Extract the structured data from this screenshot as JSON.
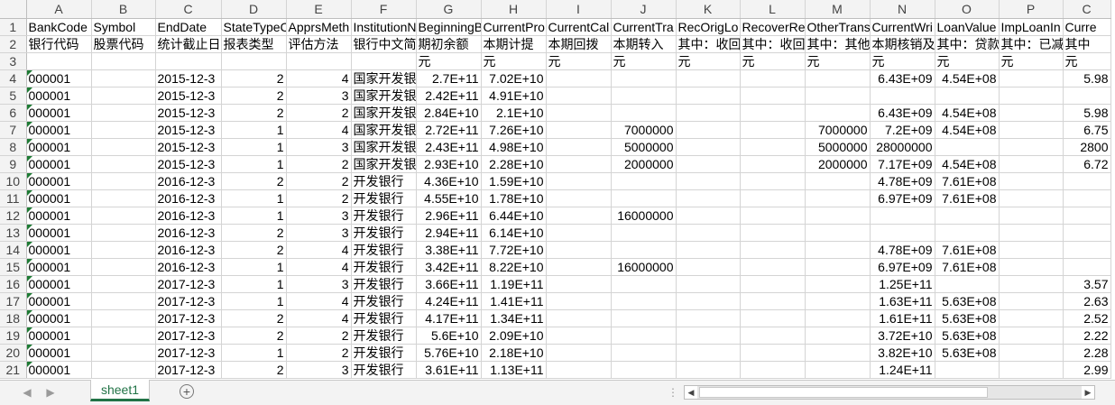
{
  "columns": [
    "A",
    "B",
    "C",
    "D",
    "E",
    "F",
    "G",
    "H",
    "I",
    "J",
    "K",
    "L",
    "M",
    "N",
    "O",
    "P",
    "C"
  ],
  "rows": [
    {
      "n": "1",
      "c": [
        "BankCode",
        "Symbol",
        "EndDate",
        "StateTypeC",
        "ApprsMeth",
        "InstitutionN",
        "BeginningB",
        "CurrentPro",
        "CurrentCal",
        "CurrentTra",
        "RecOrigLo",
        "RecoverRe",
        "OtherTrans",
        "CurrentWri",
        "LoanValue",
        "ImpLoanIn",
        "Curre"
      ]
    },
    {
      "n": "2",
      "c": [
        "银行代码",
        "股票代码",
        "统计截止日",
        "报表类型",
        "评估方法",
        "银行中文简",
        "期初余额",
        "本期计提",
        "本期回拨",
        "本期转入",
        "其中：收回",
        "其中：收回",
        "其中：其他",
        "本期核销及",
        "其中：贷款",
        "其中：已减",
        "其中"
      ]
    },
    {
      "n": "3",
      "c": [
        "",
        "",
        "",
        "",
        "",
        "",
        "元",
        "元",
        "元",
        "元",
        "元",
        "元",
        "元",
        "元",
        "元",
        "元",
        "元"
      ]
    },
    {
      "n": "4",
      "c": [
        "000001",
        "",
        "2015-12-3",
        "2",
        "4",
        "国家开发银",
        "2.7E+11",
        "7.02E+10",
        "",
        "",
        "",
        "",
        "",
        "6.43E+09",
        "4.54E+08",
        "",
        "5.98"
      ]
    },
    {
      "n": "5",
      "c": [
        "000001",
        "",
        "2015-12-3",
        "2",
        "3",
        "国家开发银",
        "2.42E+11",
        "4.91E+10",
        "",
        "",
        "",
        "",
        "",
        "",
        "",
        "",
        ""
      ]
    },
    {
      "n": "6",
      "c": [
        "000001",
        "",
        "2015-12-3",
        "2",
        "2",
        "国家开发银",
        "2.84E+10",
        "2.1E+10",
        "",
        "",
        "",
        "",
        "",
        "6.43E+09",
        "4.54E+08",
        "",
        "5.98"
      ]
    },
    {
      "n": "7",
      "c": [
        "000001",
        "",
        "2015-12-3",
        "1",
        "4",
        "国家开发银",
        "2.72E+11",
        "7.26E+10",
        "",
        "7000000",
        "",
        "",
        "7000000",
        "7.2E+09",
        "4.54E+08",
        "",
        "6.75"
      ]
    },
    {
      "n": "8",
      "c": [
        "000001",
        "",
        "2015-12-3",
        "1",
        "3",
        "国家开发银",
        "2.43E+11",
        "4.98E+10",
        "",
        "5000000",
        "",
        "",
        "5000000",
        "28000000",
        "",
        "",
        "2800"
      ]
    },
    {
      "n": "9",
      "c": [
        "000001",
        "",
        "2015-12-3",
        "1",
        "2",
        "国家开发银",
        "2.93E+10",
        "2.28E+10",
        "",
        "2000000",
        "",
        "",
        "2000000",
        "7.17E+09",
        "4.54E+08",
        "",
        "6.72"
      ]
    },
    {
      "n": "10",
      "c": [
        "000001",
        "",
        "2016-12-3",
        "2",
        "2",
        "开发银行",
        "4.36E+10",
        "1.59E+10",
        "",
        "",
        "",
        "",
        "",
        "4.78E+09",
        "7.61E+08",
        "",
        ""
      ]
    },
    {
      "n": "11",
      "c": [
        "000001",
        "",
        "2016-12-3",
        "1",
        "2",
        "开发银行",
        "4.55E+10",
        "1.78E+10",
        "",
        "",
        "",
        "",
        "",
        "6.97E+09",
        "7.61E+08",
        "",
        ""
      ]
    },
    {
      "n": "12",
      "c": [
        "000001",
        "",
        "2016-12-3",
        "1",
        "3",
        "开发银行",
        "2.96E+11",
        "6.44E+10",
        "",
        "16000000",
        "",
        "",
        "",
        "",
        "",
        "",
        ""
      ]
    },
    {
      "n": "13",
      "c": [
        "000001",
        "",
        "2016-12-3",
        "2",
        "3",
        "开发银行",
        "2.94E+11",
        "6.14E+10",
        "",
        "",
        "",
        "",
        "",
        "",
        "",
        "",
        ""
      ]
    },
    {
      "n": "14",
      "c": [
        "000001",
        "",
        "2016-12-3",
        "2",
        "4",
        "开发银行",
        "3.38E+11",
        "7.72E+10",
        "",
        "",
        "",
        "",
        "",
        "4.78E+09",
        "7.61E+08",
        "",
        ""
      ]
    },
    {
      "n": "15",
      "c": [
        "000001",
        "",
        "2016-12-3",
        "1",
        "4",
        "开发银行",
        "3.42E+11",
        "8.22E+10",
        "",
        "16000000",
        "",
        "",
        "",
        "6.97E+09",
        "7.61E+08",
        "",
        ""
      ]
    },
    {
      "n": "16",
      "c": [
        "000001",
        "",
        "2017-12-3",
        "1",
        "3",
        "开发银行",
        "3.66E+11",
        "1.19E+11",
        "",
        "",
        "",
        "",
        "",
        "1.25E+11",
        "",
        "",
        "3.57"
      ]
    },
    {
      "n": "17",
      "c": [
        "000001",
        "",
        "2017-12-3",
        "1",
        "4",
        "开发银行",
        "4.24E+11",
        "1.41E+11",
        "",
        "",
        "",
        "",
        "",
        "1.63E+11",
        "5.63E+08",
        "",
        "2.63"
      ]
    },
    {
      "n": "18",
      "c": [
        "000001",
        "",
        "2017-12-3",
        "2",
        "4",
        "开发银行",
        "4.17E+11",
        "1.34E+11",
        "",
        "",
        "",
        "",
        "",
        "1.61E+11",
        "5.63E+08",
        "",
        "2.52"
      ]
    },
    {
      "n": "19",
      "c": [
        "000001",
        "",
        "2017-12-3",
        "2",
        "2",
        "开发银行",
        "5.6E+10",
        "2.09E+10",
        "",
        "",
        "",
        "",
        "",
        "3.72E+10",
        "5.63E+08",
        "",
        "2.22"
      ]
    },
    {
      "n": "20",
      "c": [
        "000001",
        "",
        "2017-12-3",
        "1",
        "2",
        "开发银行",
        "5.76E+10",
        "2.18E+10",
        "",
        "",
        "",
        "",
        "",
        "3.82E+10",
        "5.63E+08",
        "",
        "2.28"
      ]
    },
    {
      "n": "21",
      "c": [
        "000001",
        "",
        "2017-12-3",
        "2",
        "3",
        "开发银行",
        "3.61E+11",
        "1.13E+11",
        "",
        "",
        "",
        "",
        "",
        "1.24E+11",
        "",
        "",
        "2.99"
      ]
    }
  ],
  "sheet_tab": "sheet1",
  "add_sheet_icon": "plus-circle-icon",
  "accent_color": "#217346",
  "error_marker_color": "#1e7b34"
}
